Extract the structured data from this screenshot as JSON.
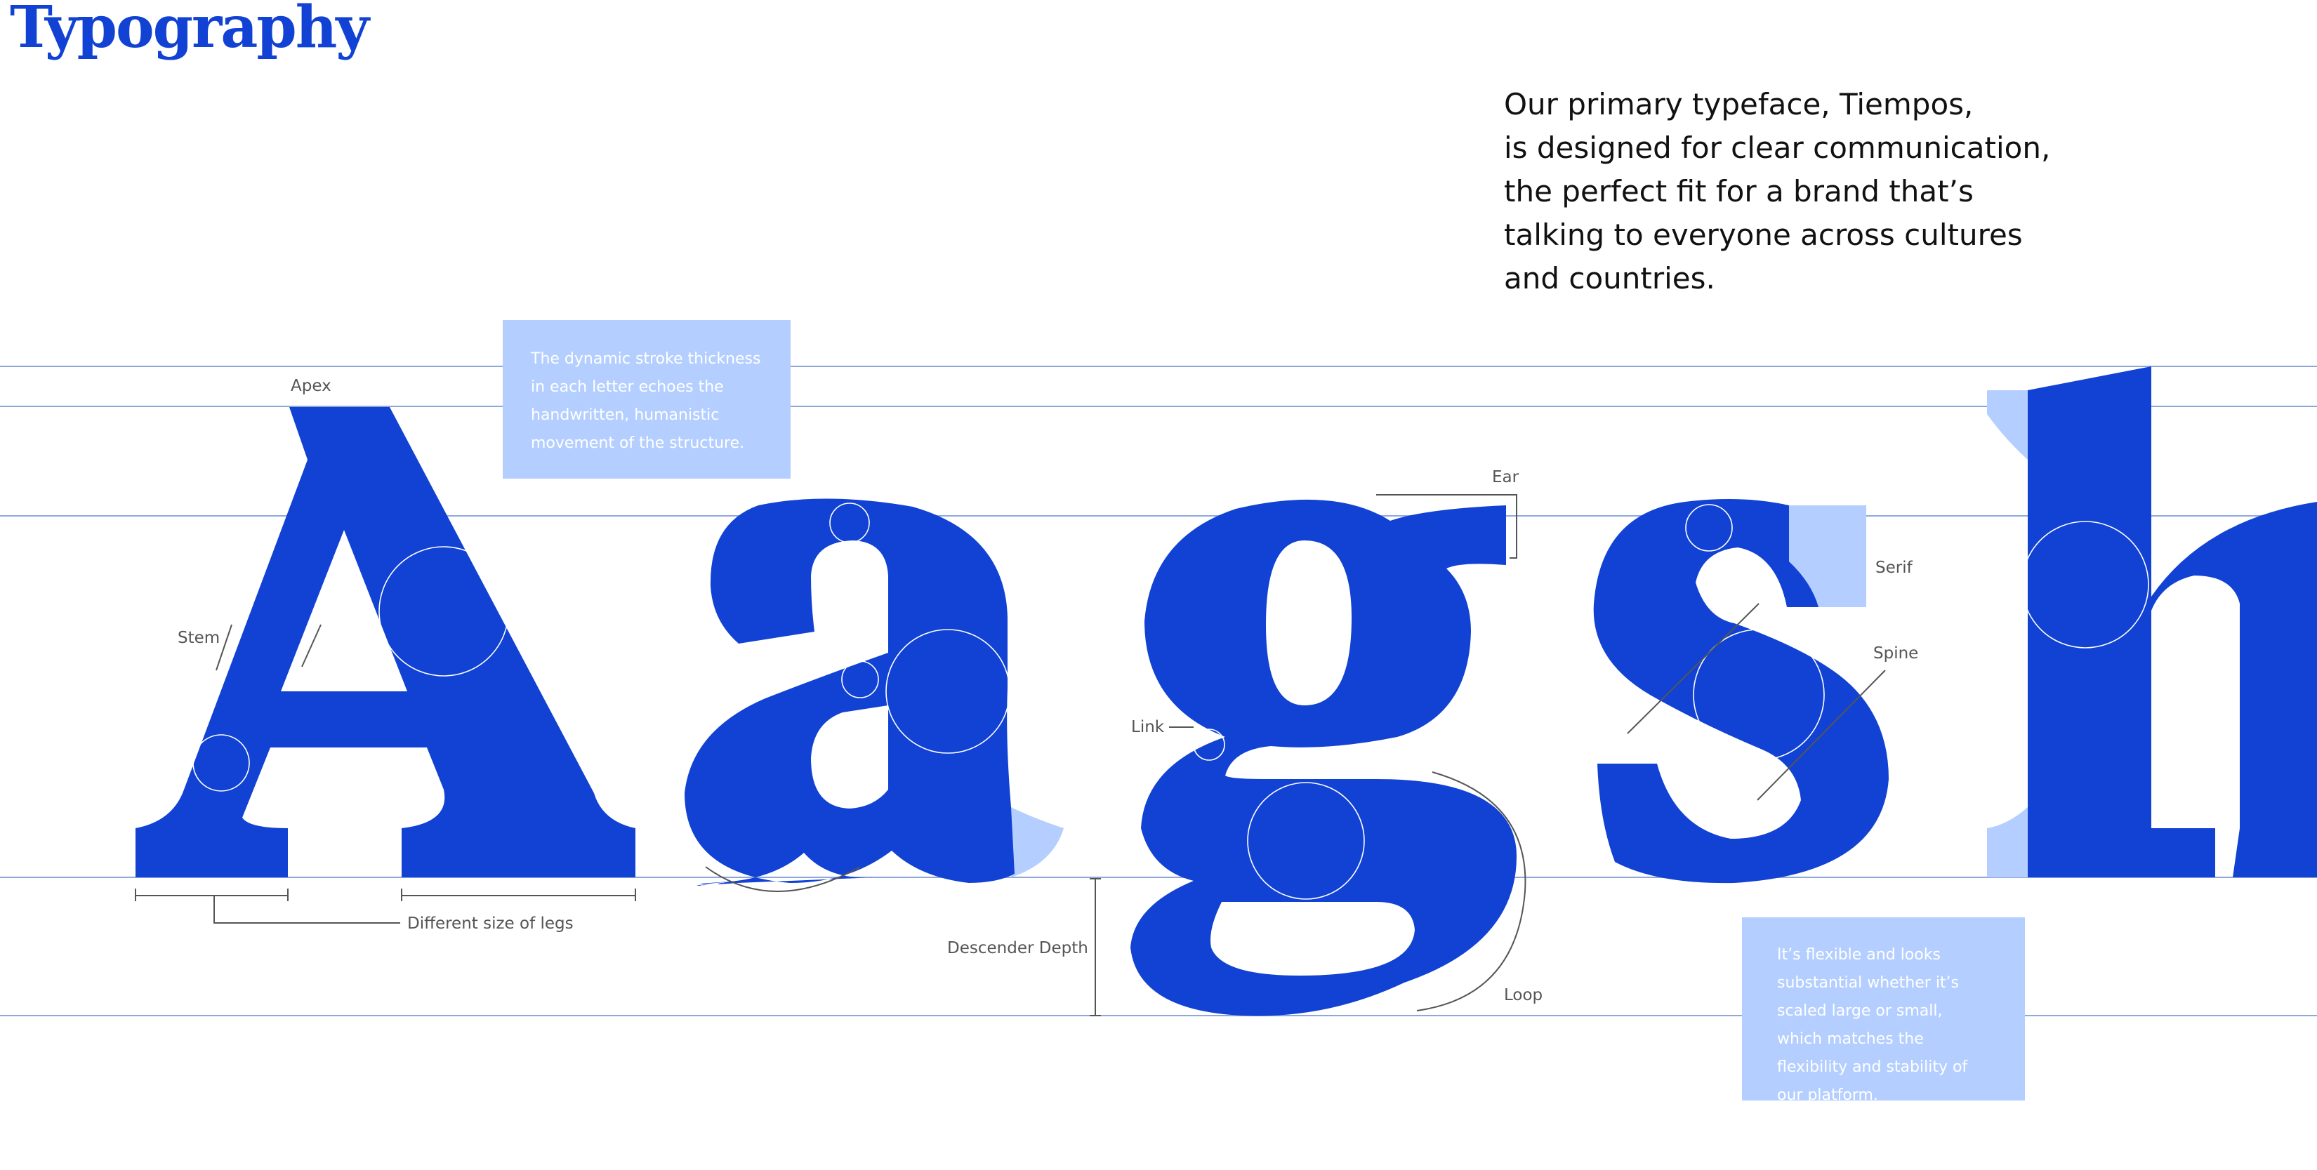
{
  "title": "Typography",
  "intro": {
    "lines": [
      "Our primary typeface, Tiempos,",
      "is designed for clear communication,",
      "the perfect fit for a brand that’s",
      "talking to everyone across cultures",
      "and countries."
    ]
  },
  "notes": {
    "stroke": "The dynamic stroke thickness in each letter echoes the handwritten, humanistic movement of the structure.",
    "flexible": "It’s flexible and looks substantial whether it’s scaled large or small, which matches the flexibility and stability of our platform."
  },
  "specimen": {
    "letters": [
      "A",
      "a",
      "g",
      "s",
      "h"
    ]
  },
  "labels": {
    "apex": "Apex",
    "stem": "Stem",
    "legs": "Different size of legs",
    "link": "Link",
    "ear": "Ear",
    "descender_depth": "Descender Depth",
    "loop": "Loop",
    "serif": "Serif",
    "spine": "Spine"
  },
  "colors": {
    "brand_blue": "#1142D3",
    "light_blue": "#B4CFFF",
    "guide_line": "#8FA8DC",
    "annotation": "#555555"
  }
}
